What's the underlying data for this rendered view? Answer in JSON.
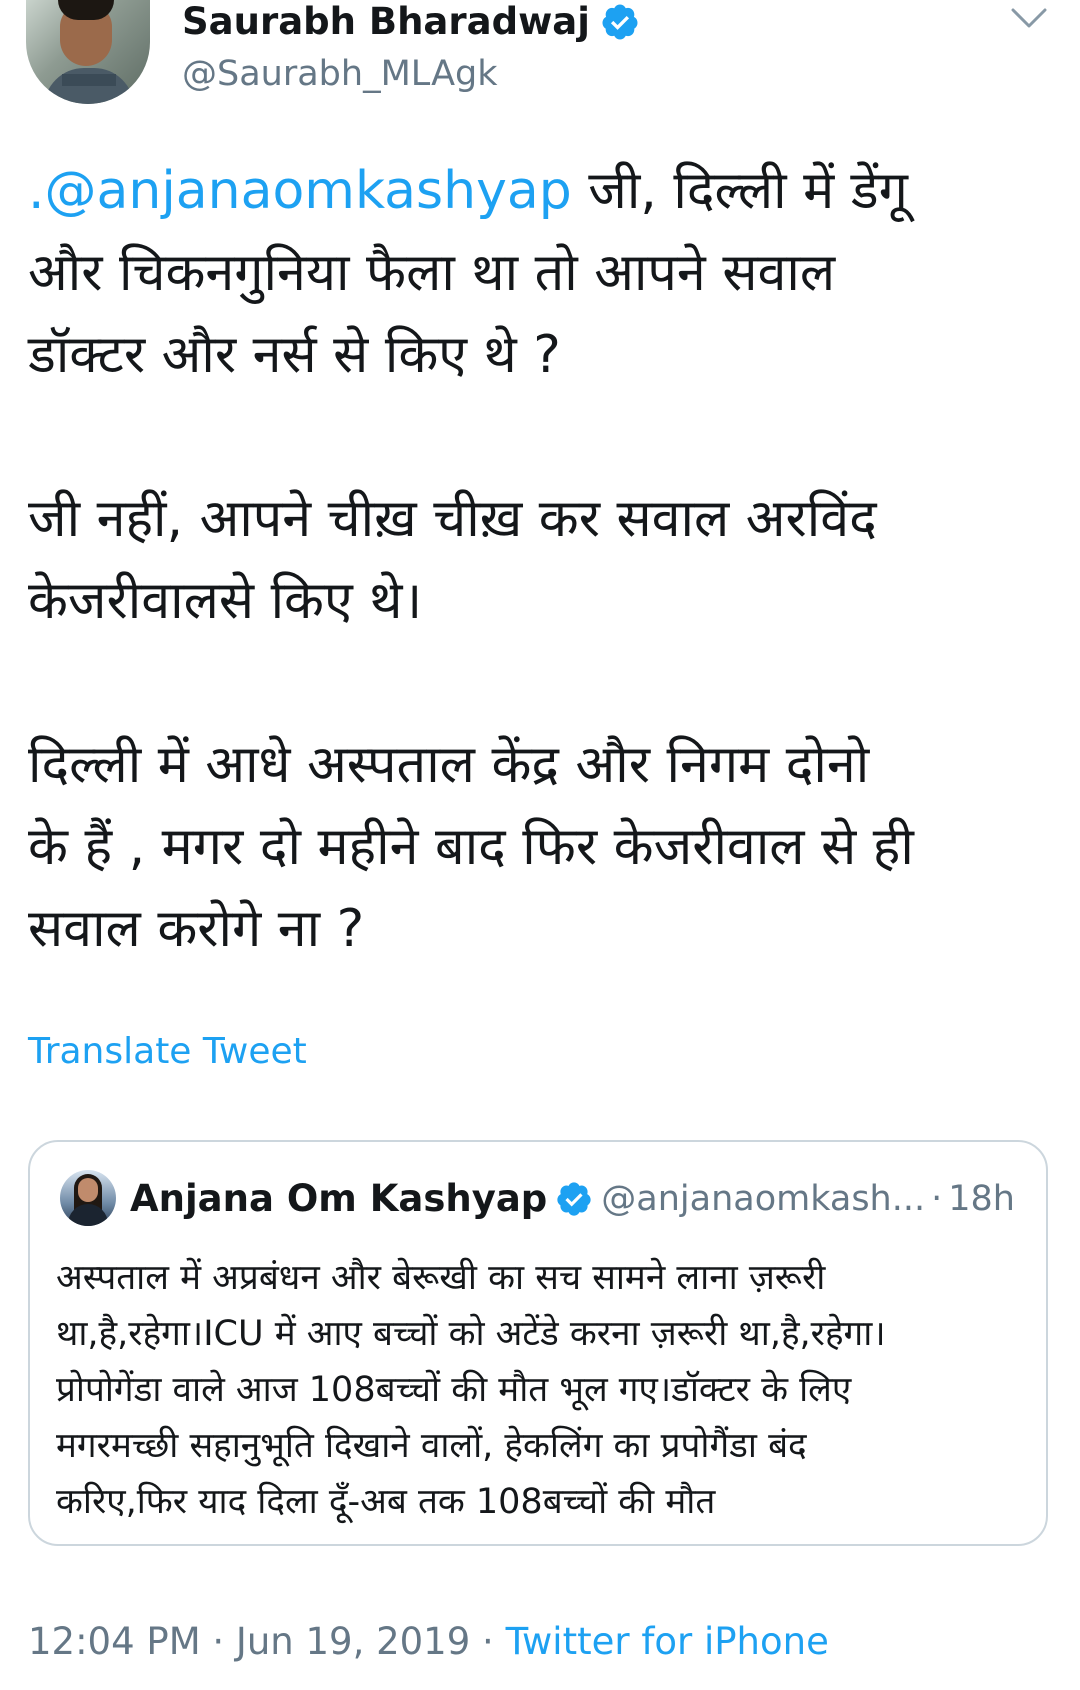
{
  "tweet": {
    "author": {
      "name": "Saurabh Bharadwaj",
      "handle": "@Saurabh_MLAgk",
      "verified": true
    },
    "text": {
      "mention": ".@anjanaomkashyap",
      "body": " जी, दिल्ली में डेंगू\nऔर चिकनगुनिया फैला था तो आपने सवाल\nडॉक्टर और नर्स से किए थे ?\n\nजी नहीं, आपने चीख़ चीख़ कर सवाल अरविंद\nकेजरीवालसे किए थे।\n\nदिल्ली में आधे अस्पताल केंद्र और निगम दोनो\nके हैं , मगर दो महीने बाद फिर केजरीवाल से ही\nसवाल करोगे ना ?"
    },
    "translate_label": "Translate Tweet",
    "quoted": {
      "name": "Anjana Om Kashyap",
      "handle": "@anjanaomkash...",
      "separator": "·",
      "time": "18h",
      "verified": true,
      "text": "अस्पताल में अप्रबंधन और बेरूखी का सच सामने लाना ज़रूरी\nथा,है,रहेगा।ICU में आए बच्चों को अटेंडे करना ज़रूरी था,है,रहेगा।\nप्रोपोगेंडा वाले आज 108बच्चों की मौत भूल गए।डॉक्टर के लिए\nमगरमच्छी सहानुभूति दिखाने वालों, हेकलिंग का प्रपोगैंडा बंद\nकरिए,फिर याद दिला दूँ-अब तक 108बच्चों की मौत"
    },
    "meta": {
      "time": "12:04 PM",
      "separator": "·",
      "date": "Jun 19, 2019",
      "source": "Twitter for iPhone"
    }
  },
  "icons": {
    "verified": "verified-badge-icon",
    "menu": "chevron-down-icon"
  },
  "colors": {
    "accent": "#1da1f2",
    "secondary_text": "#657786",
    "border": "#ccd6dd"
  }
}
